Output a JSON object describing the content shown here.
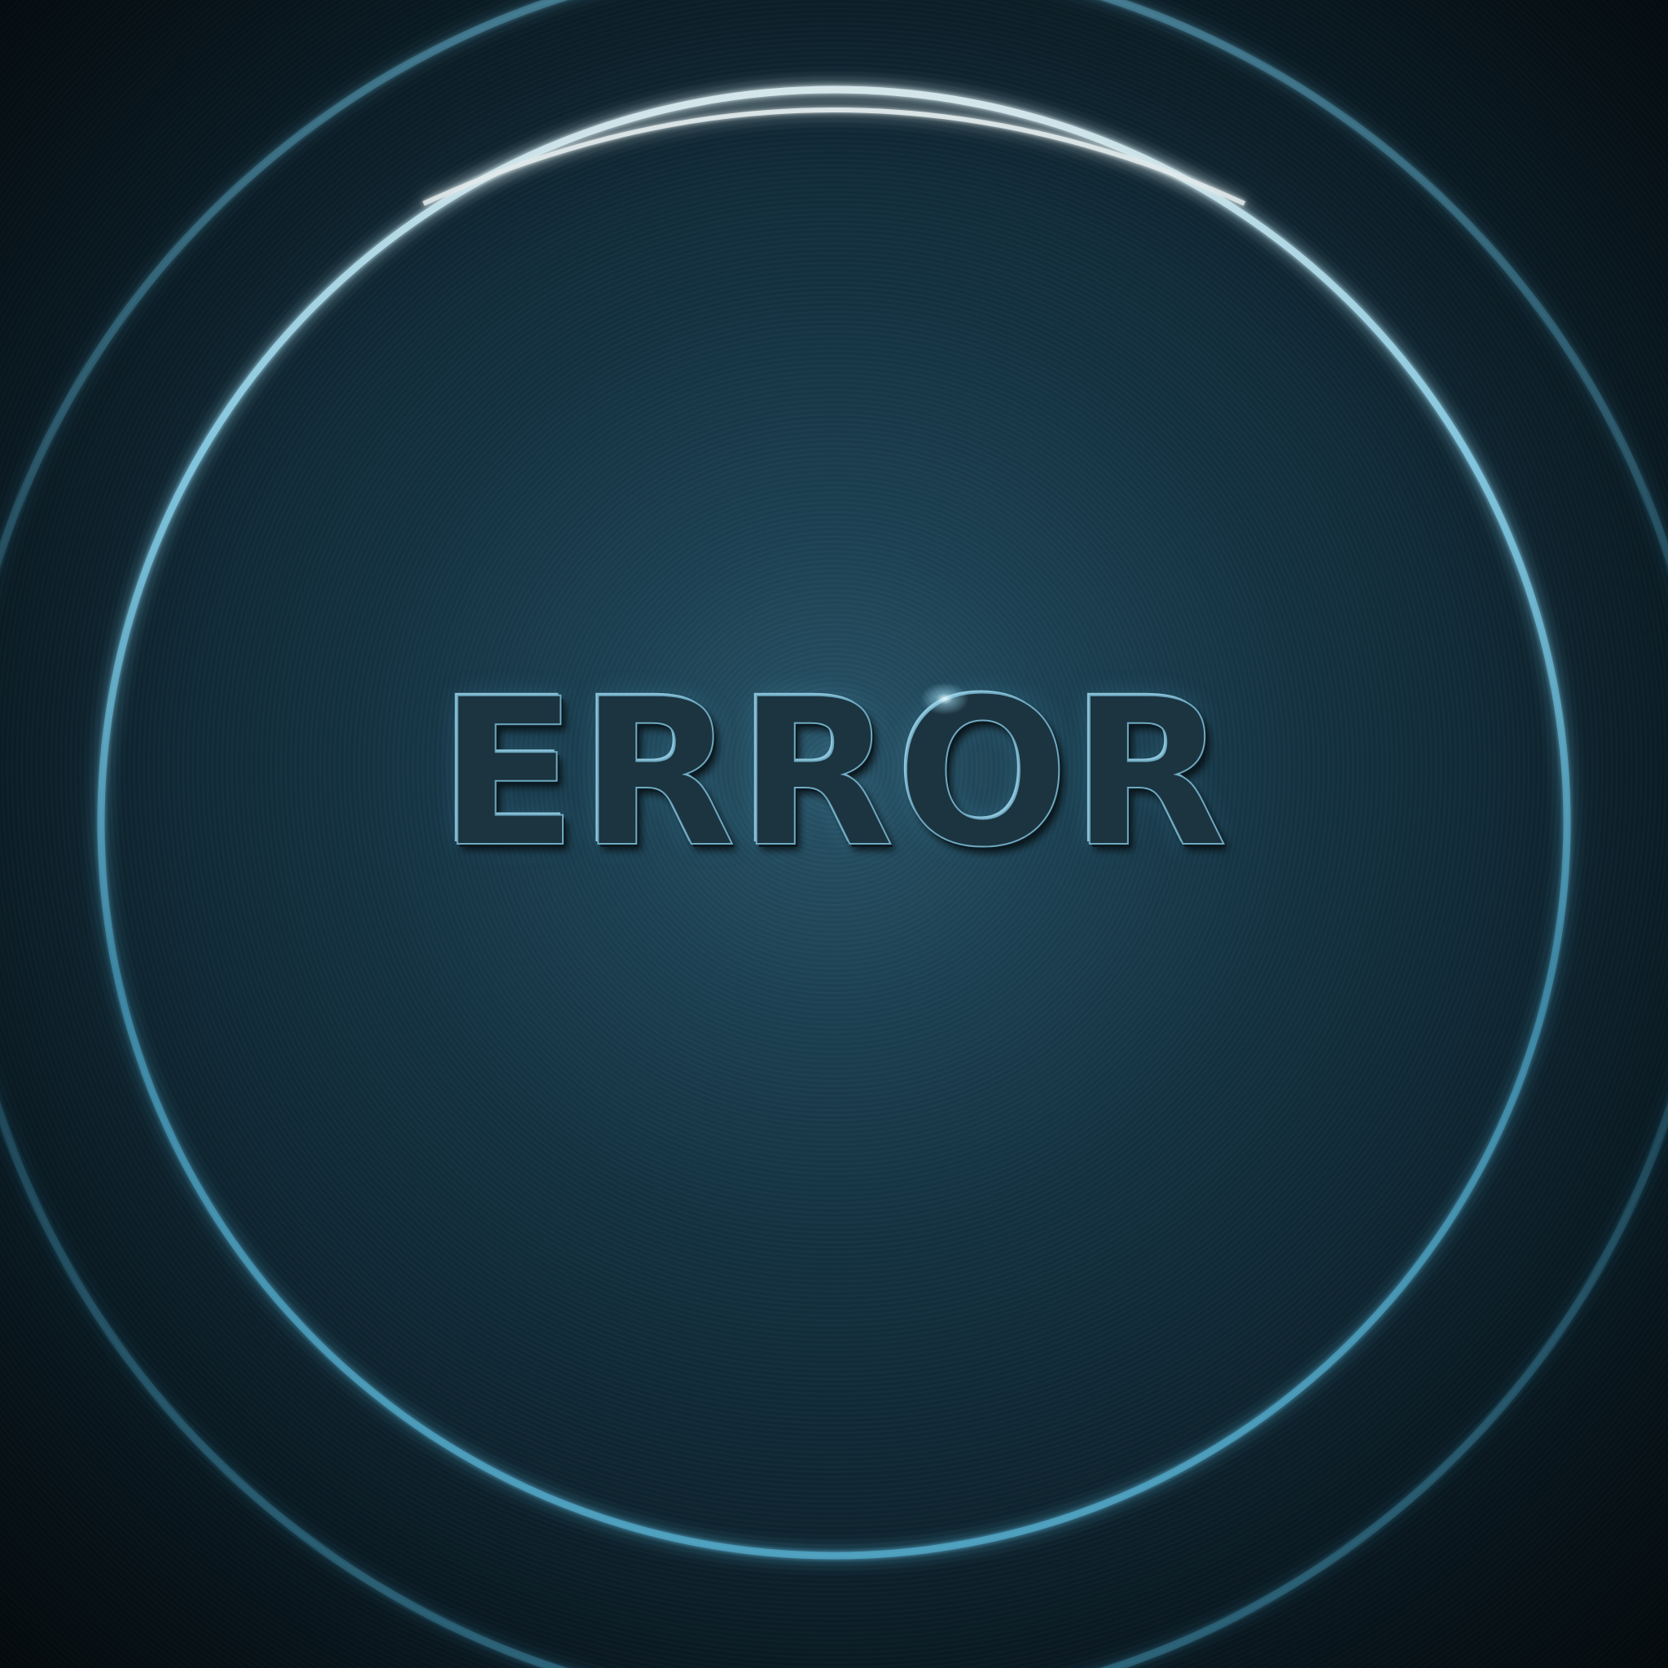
{
  "message": {
    "title": "ERROR"
  },
  "colors": {
    "background_center": "#2a5468",
    "background_edge": "#071319",
    "ring_glow": "#8fd8f2",
    "text_face": "#1c3440",
    "text_highlight": "#8fc6dc"
  }
}
